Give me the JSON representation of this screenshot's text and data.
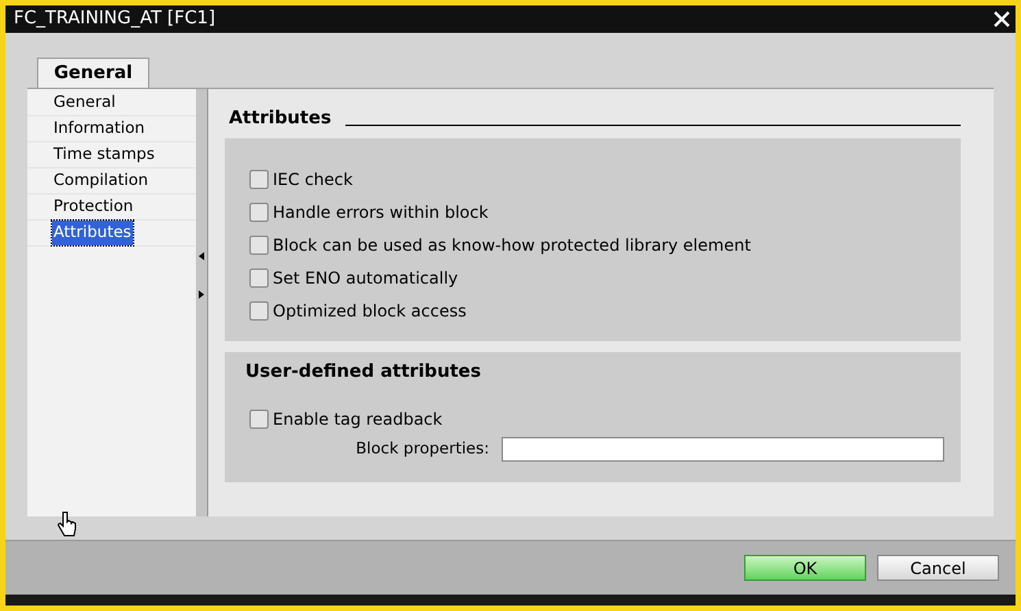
{
  "window": {
    "title": "FC_TRAINING_AT [FC1]"
  },
  "tabs": [
    {
      "label": "General",
      "selected": true
    }
  ],
  "sidebar": {
    "items": [
      {
        "label": "General",
        "selected": false
      },
      {
        "label": "Information",
        "selected": false
      },
      {
        "label": "Time stamps",
        "selected": false
      },
      {
        "label": "Compilation",
        "selected": false
      },
      {
        "label": "Protection",
        "selected": false
      },
      {
        "label": "Attributes",
        "selected": true
      }
    ]
  },
  "section": {
    "title": "Attributes",
    "options": [
      {
        "label": "IEC check",
        "checked": false
      },
      {
        "label": "Handle errors within block",
        "checked": false
      },
      {
        "label": "Block can be used as know-how protected library element",
        "checked": false
      },
      {
        "label": "Set ENO automatically",
        "checked": false
      },
      {
        "label": "Optimized block access",
        "checked": false
      }
    ]
  },
  "user_defined": {
    "title": "User-defined attributes",
    "options": [
      {
        "label": "Enable tag readback",
        "checked": false
      }
    ],
    "field": {
      "label": "Block properties:"
    }
  },
  "buttons": [
    {
      "label": "OK",
      "kind": "primary"
    },
    {
      "label": "Cancel",
      "kind": "secondary"
    }
  ]
}
